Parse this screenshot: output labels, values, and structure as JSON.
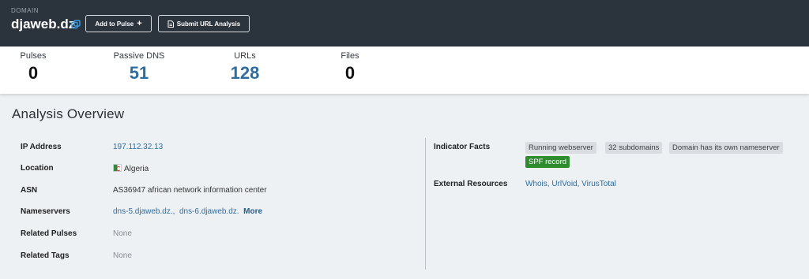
{
  "header": {
    "type_label": "DOMAIN",
    "domain": "djaweb.dz",
    "add_pulse_label": "Add to Pulse",
    "add_pulse_icon": "+",
    "submit_url_label": "Submit URL Analysis"
  },
  "stats": [
    {
      "label": "Pulses",
      "value": "0"
    },
    {
      "label": "Passive DNS",
      "value": "51"
    },
    {
      "label": "URLs",
      "value": "128"
    },
    {
      "label": "Files",
      "value": "0"
    }
  ],
  "overview": {
    "title": "Analysis Overview",
    "left": {
      "ip_label": "IP Address",
      "ip_value": "197.112.32.13",
      "location_label": "Location",
      "location_value": "Algeria",
      "asn_label": "ASN",
      "asn_value": "AS36947 african network information center",
      "ns_label": "Nameservers",
      "ns_values": [
        "dns-5.djaweb.dz.,",
        "dns-6.djaweb.dz."
      ],
      "ns_more": "More",
      "pulses_label": "Related Pulses",
      "pulses_value": "None",
      "tags_label": "Related Tags",
      "tags_value": "None"
    },
    "right": {
      "facts_label": "Indicator Facts",
      "facts": [
        "Running webserver",
        "32 subdomains",
        "Domain has its own nameserver",
        "SPF record"
      ],
      "external_label": "External Resources",
      "external_links": [
        "Whois",
        "UrlVoid",
        "VirusTotal"
      ]
    }
  },
  "colors": {
    "header_bg": "#2b333c",
    "link": "#2f6d9f",
    "spf_green": "#2e8b2e"
  }
}
